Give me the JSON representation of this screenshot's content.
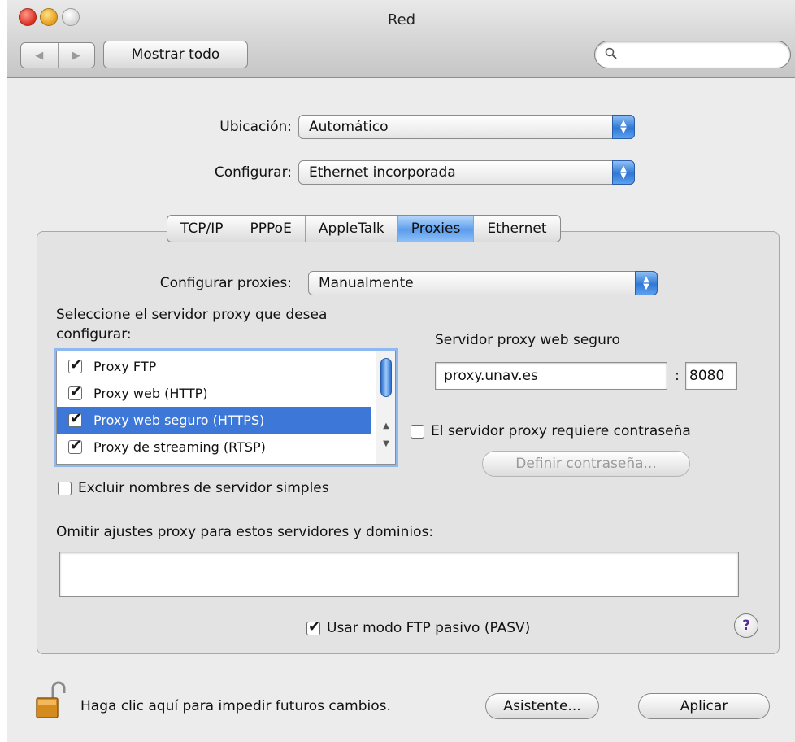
{
  "window": {
    "title": "Red"
  },
  "toolbar": {
    "back_glyph": "◀",
    "forward_glyph": "▶",
    "show_all_label": "Mostrar todo",
    "search_placeholder": "",
    "search_icon": "magnifier-icon"
  },
  "location": {
    "label": "Ubicación:",
    "value": "Automático"
  },
  "configure": {
    "label": "Configurar:",
    "value": "Ethernet incorporada"
  },
  "tabs": [
    {
      "label": "TCP/IP",
      "active": false
    },
    {
      "label": "PPPoE",
      "active": false
    },
    {
      "label": "AppleTalk",
      "active": false
    },
    {
      "label": "Proxies",
      "active": true
    },
    {
      "label": "Ethernet",
      "active": false
    }
  ],
  "proxies": {
    "configure_label": "Configurar proxies:",
    "configure_value": "Manualmente",
    "select_prompt_line1": "Seleccione el servidor proxy que desea",
    "select_prompt_line2": "configurar:",
    "list": [
      {
        "label": "Proxy FTP",
        "checked": true,
        "selected": false
      },
      {
        "label": "Proxy web (HTTP)",
        "checked": true,
        "selected": false
      },
      {
        "label": "Proxy web seguro (HTTPS)",
        "checked": true,
        "selected": true
      },
      {
        "label": "Proxy de streaming (RTSP)",
        "checked": true,
        "selected": false
      }
    ],
    "server_title": "Servidor proxy web seguro",
    "server_host": "proxy.unav.es",
    "port_separator": ":",
    "server_port": "8080",
    "requires_password_label": "El servidor proxy requiere contraseña",
    "requires_password_checked": false,
    "set_password_label": "Definir contraseña...",
    "exclude_simple_label": "Excluir nombres de servidor simples",
    "exclude_simple_checked": false,
    "bypass_label": "Omitir ajustes proxy para estos servidores y dominios:",
    "bypass_value": "",
    "passive_ftp_label": "Usar modo FTP pasivo (PASV)",
    "passive_ftp_checked": true,
    "help_label": "?"
  },
  "footer": {
    "lock_text": "Haga clic aquí para impedir futuros cambios.",
    "assistant_label": "Asistente...",
    "apply_label": "Aplicar"
  }
}
